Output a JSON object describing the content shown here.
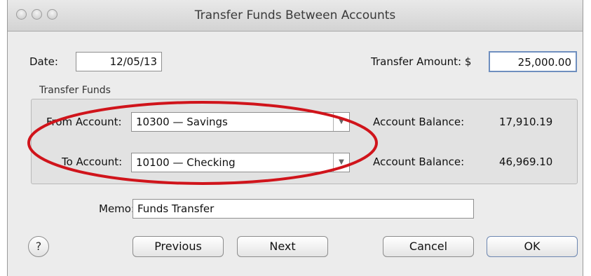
{
  "window": {
    "title": "Transfer Funds Between Accounts"
  },
  "header": {
    "date_label": "Date:",
    "date_value": "12/05/13",
    "amount_label": "Transfer Amount: $",
    "amount_value": "25,000.00"
  },
  "transfer_group": {
    "title": "Transfer Funds",
    "from_label": "From Account:",
    "from_value": "10300 — Savings",
    "from_balance_label": "Account Balance:",
    "from_balance": "17,910.19",
    "to_label": "To Account:",
    "to_value": "10100 — Checking",
    "to_balance_label": "Account Balance:",
    "to_balance": "46,969.10"
  },
  "memo": {
    "label": "Memo:",
    "value": "Funds Transfer"
  },
  "buttons": {
    "help": "?",
    "previous": "Previous",
    "next": "Next",
    "cancel": "Cancel",
    "ok": "OK"
  },
  "icons": {
    "dropdown": "chevron-down-icon",
    "annotation": "red-ellipse",
    "annotation_color": "#d0141b"
  }
}
